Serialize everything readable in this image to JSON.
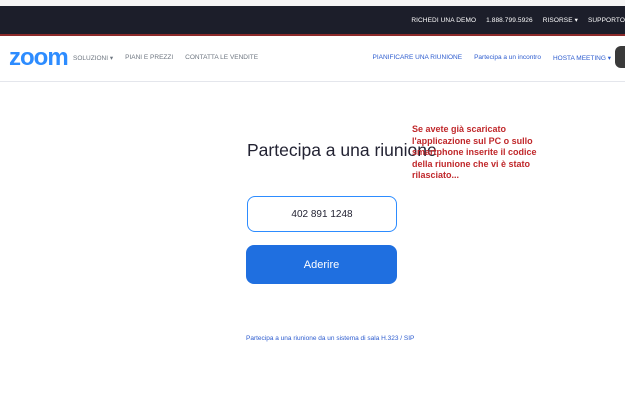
{
  "topbar": {
    "links": [
      "RICHEDI UNA DEMO",
      "1.888.799.5926",
      "RISORSE ▾",
      "SUPPORTO"
    ]
  },
  "nav": {
    "logo": "zoom",
    "left": [
      "SOLUZIONI ▾",
      "PIANI E PREZZI",
      "CONTATTA LE VENDITE"
    ],
    "right": [
      "PIANIFICARE UNA RIUNIONE",
      "Partecipa a un incontro",
      "HOSTA MEETING ▾"
    ]
  },
  "main": {
    "title": "Partecipa a una riunione",
    "meeting_id_value": "402 891 1248",
    "join_label": "Aderire",
    "h323_link": "Partecipa a una riunione da un sistema di sala H.323 / SIP"
  },
  "annotation": {
    "lines": [
      "Se avete già scaricato",
      "l'applicazione sul PC o sullo",
      "smartphone inserite il codice",
      "della riunione che vi è stato",
      "rilasciato..."
    ]
  },
  "colors": {
    "brand": "#2d8cff",
    "button": "#1f6fe0",
    "topbar": "#1c1e2a",
    "annotation": "#c0282b"
  }
}
